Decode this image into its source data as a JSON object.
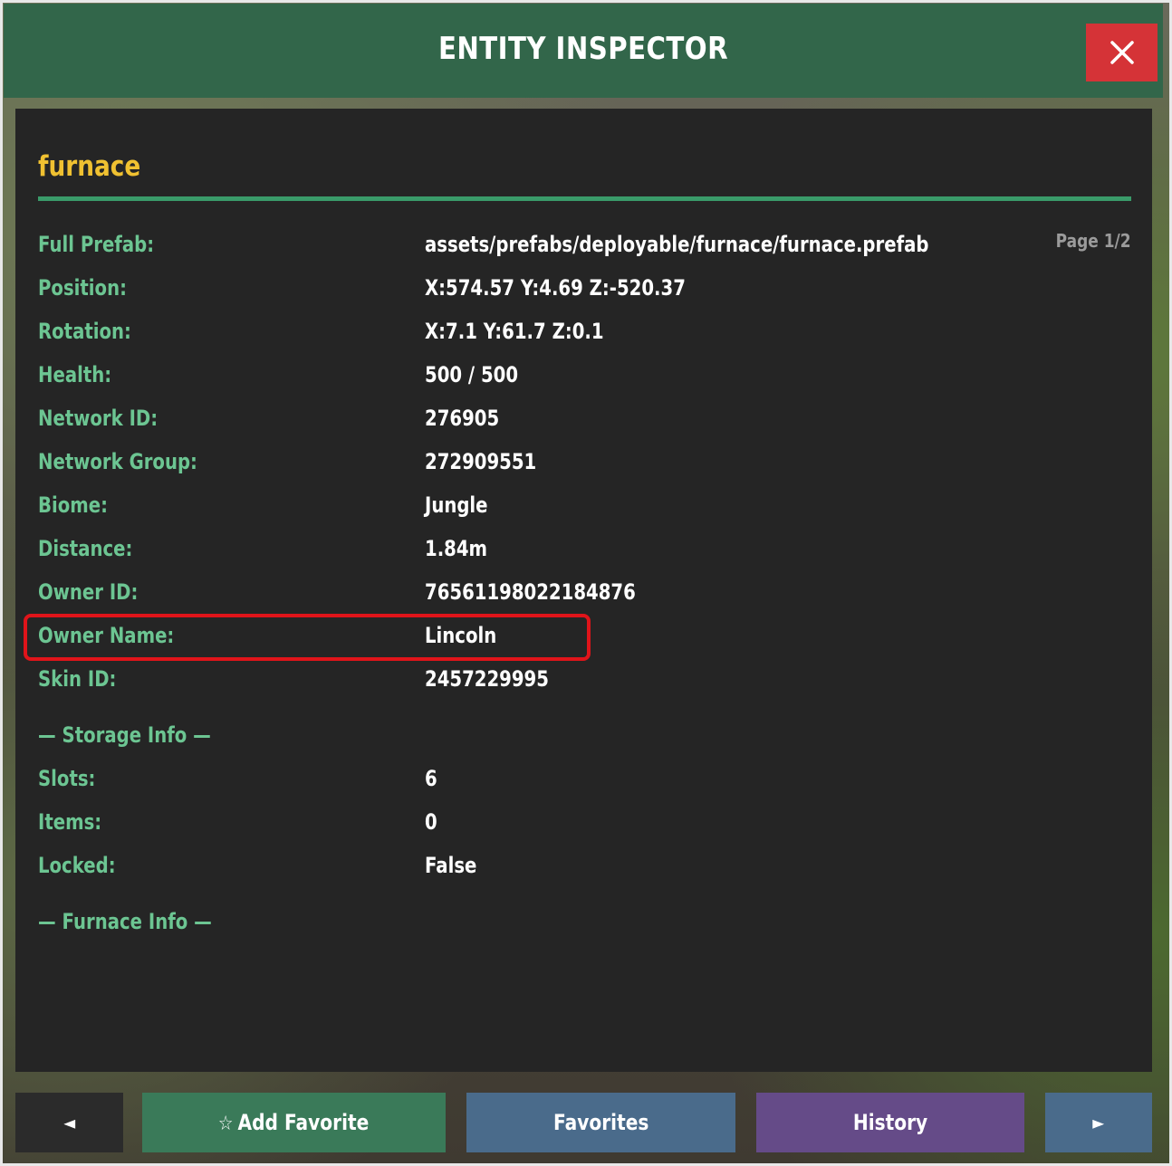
{
  "window": {
    "title": "ENTITY INSPECTOR",
    "close_icon": "close-icon"
  },
  "entity": {
    "name": "furnace",
    "page": "Page 1/2"
  },
  "properties": [
    {
      "label": "Full Prefab:",
      "value": "assets/prefabs/deployable/furnace/furnace.prefab"
    },
    {
      "label": "Position:",
      "value": "X:574.57 Y:4.69 Z:-520.37"
    },
    {
      "label": "Rotation:",
      "value": "X:7.1 Y:61.7 Z:0.1"
    },
    {
      "label": "Health:",
      "value": "500 / 500"
    },
    {
      "label": "Network ID:",
      "value": "276905"
    },
    {
      "label": "Network Group:",
      "value": "272909551"
    },
    {
      "label": "Biome:",
      "value": "Jungle"
    },
    {
      "label": "Distance:",
      "value": "1.84m"
    },
    {
      "label": "Owner ID:",
      "value": "76561198022184876"
    },
    {
      "label": "Owner Name:",
      "value": "Lincoln"
    },
    {
      "label": "Skin ID:",
      "value": "2457229995"
    }
  ],
  "storage": {
    "title": "— Storage Info —",
    "properties": [
      {
        "label": "Slots:",
        "value": "6"
      },
      {
        "label": "Items:",
        "value": "0"
      },
      {
        "label": "Locked:",
        "value": "False"
      }
    ]
  },
  "furnace": {
    "title": "— Furnace Info —"
  },
  "buttons": {
    "prev": "◄",
    "add_favorite_icon": "☆",
    "add_favorite": "Add Favorite",
    "favorites": "Favorites",
    "history": "History",
    "next": "►"
  },
  "colors": {
    "titlebar": "#32664a",
    "panel": "#252525",
    "label": "#6cc592",
    "entity_name": "#f0c131",
    "close": "#d53337",
    "highlight": "#e0141a"
  }
}
